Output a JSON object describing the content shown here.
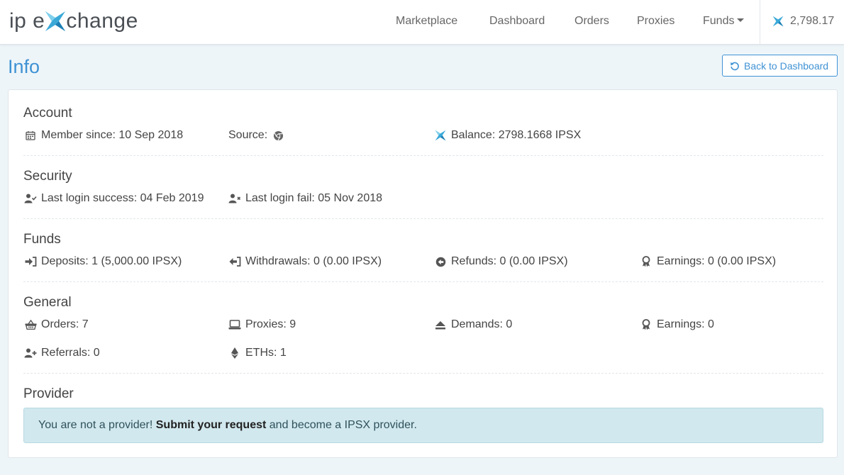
{
  "brand": {
    "logo_prefix": "ip e",
    "logo_suffix": "change",
    "accent": "#3f92d4"
  },
  "nav": {
    "items": [
      "Marketplace",
      "Dashboard",
      "Orders",
      "Proxies",
      "Funds"
    ],
    "balance": "2,798.17"
  },
  "page": {
    "title": "Info",
    "back_label": "Back to Dashboard"
  },
  "account": {
    "title": "Account",
    "member_since": "Member since: 10 Sep 2018",
    "source": "Source:",
    "balance": "Balance: 2798.1668 IPSX"
  },
  "security": {
    "title": "Security",
    "last_success": "Last login success: 04 Feb 2019",
    "last_fail": "Last login fail: 05 Nov 2018"
  },
  "funds": {
    "title": "Funds",
    "deposits": "Deposits: 1 (5,000.00 IPSX)",
    "withdrawals": "Withdrawals: 0 (0.00 IPSX)",
    "refunds": "Refunds: 0 (0.00 IPSX)",
    "earnings": "Earnings: 0 (0.00 IPSX)"
  },
  "general": {
    "title": "General",
    "orders": "Orders: 7",
    "proxies": "Proxies: 9",
    "demands": "Demands: 0",
    "earnings": "Earnings: 0",
    "referrals": "Referrals: 0",
    "eths": "ETHs: 1"
  },
  "provider": {
    "title": "Provider",
    "alert_prefix": "You are not a provider!",
    "alert_link": "Submit your request",
    "alert_suffix": "and become a IPSX provider."
  },
  "icons": {
    "logo": "ipx-x-logo-icon",
    "calendar": "calendar-icon",
    "chrome": "chrome-icon",
    "user_check": "user-check-icon",
    "user_x": "user-times-icon",
    "sign_in": "sign-in-icon",
    "sign_out": "sign-out-icon",
    "arrow_left_circle": "arrow-circle-left-icon",
    "award": "award-icon",
    "basket": "shopping-basket-icon",
    "laptop": "laptop-icon",
    "eject": "eject-icon",
    "user_plus": "user-plus-icon",
    "ethereum": "ethereum-icon",
    "undo": "undo-icon"
  }
}
